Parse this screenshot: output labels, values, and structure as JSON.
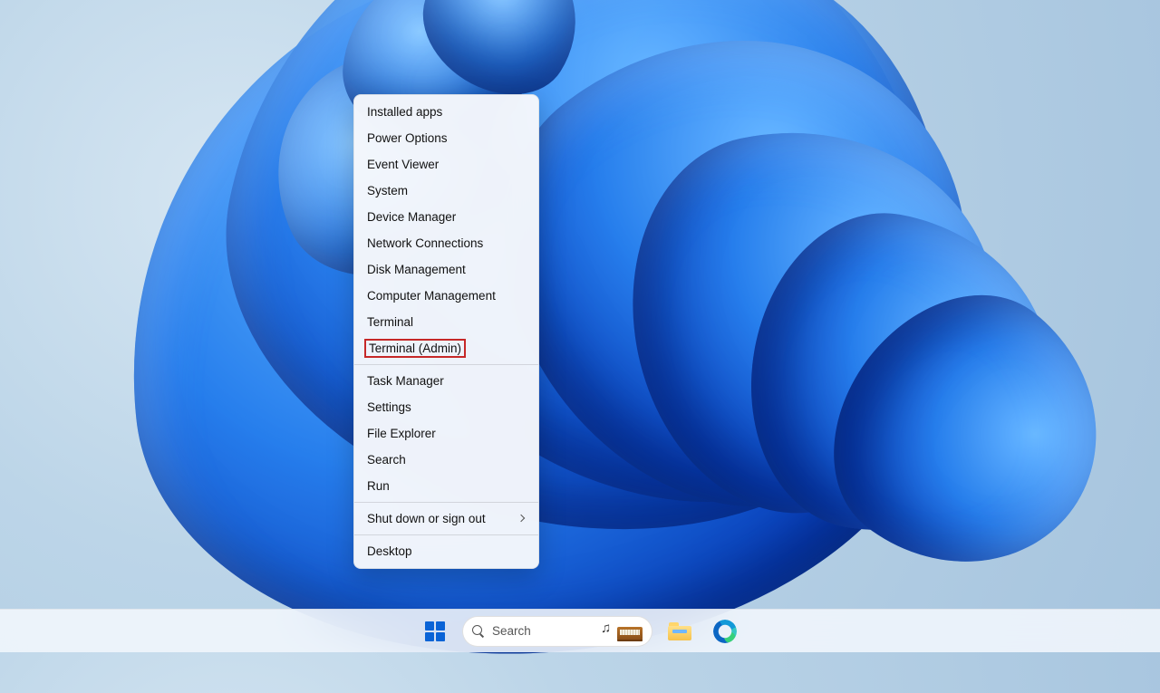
{
  "context_menu": {
    "items": [
      {
        "label": "Installed apps",
        "name": "menu-item-installed-apps",
        "submenu": false
      },
      {
        "label": "Power Options",
        "name": "menu-item-power-options",
        "submenu": false
      },
      {
        "label": "Event Viewer",
        "name": "menu-item-event-viewer",
        "submenu": false
      },
      {
        "label": "System",
        "name": "menu-item-system",
        "submenu": false
      },
      {
        "label": "Device Manager",
        "name": "menu-item-device-manager",
        "submenu": false
      },
      {
        "label": "Network Connections",
        "name": "menu-item-network-connections",
        "submenu": false
      },
      {
        "label": "Disk Management",
        "name": "menu-item-disk-management",
        "submenu": false
      },
      {
        "label": "Computer Management",
        "name": "menu-item-computer-management",
        "submenu": false
      },
      {
        "label": "Terminal",
        "name": "menu-item-terminal",
        "submenu": false
      },
      {
        "label": "Terminal (Admin)",
        "name": "menu-item-terminal-admin",
        "submenu": false,
        "highlight": true
      }
    ],
    "items2": [
      {
        "label": "Task Manager",
        "name": "menu-item-task-manager",
        "submenu": false
      },
      {
        "label": "Settings",
        "name": "menu-item-settings",
        "submenu": false
      },
      {
        "label": "File Explorer",
        "name": "menu-item-file-explorer",
        "submenu": false
      },
      {
        "label": "Search",
        "name": "menu-item-search",
        "submenu": false
      },
      {
        "label": "Run",
        "name": "menu-item-run",
        "submenu": false
      }
    ],
    "items3": [
      {
        "label": "Shut down or sign out",
        "name": "menu-item-shutdown-signout",
        "submenu": true
      }
    ],
    "items4": [
      {
        "label": "Desktop",
        "name": "menu-item-desktop",
        "submenu": false
      }
    ]
  },
  "taskbar": {
    "search_placeholder": "Search"
  }
}
